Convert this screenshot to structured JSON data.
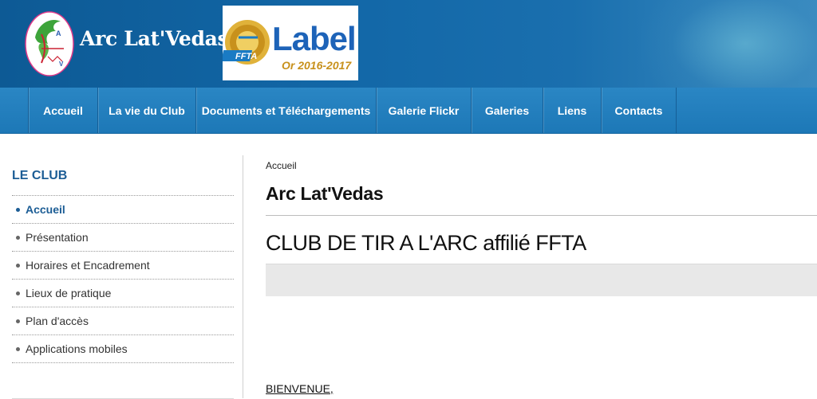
{
  "header": {
    "site_name": "Arc Lat'Vedas",
    "label_logo_text": "Label",
    "label_logo_sub": "Or 2016-2017",
    "label_logo_badge": "FFTA"
  },
  "nav": {
    "items": [
      {
        "label": "Accueil"
      },
      {
        "label": "La vie du Club"
      },
      {
        "label": "Documents et Téléchargements"
      },
      {
        "label": "Galerie Flickr"
      },
      {
        "label": "Galeries"
      },
      {
        "label": "Liens"
      },
      {
        "label": "Contacts"
      }
    ]
  },
  "sidebar": {
    "title": "LE CLUB",
    "items": [
      {
        "label": "Accueil",
        "active": true
      },
      {
        "label": "Présentation"
      },
      {
        "label": "Horaires et Encadrement"
      },
      {
        "label": "Lieux de pratique"
      },
      {
        "label": "Plan d'accès"
      },
      {
        "label": "Applications mobiles"
      }
    ]
  },
  "main": {
    "breadcrumb": "Accueil",
    "title": "Arc Lat'Vedas",
    "subtitle": "CLUB DE TIR A L'ARC affilié FFTA",
    "welcome": "BIENVENUE,"
  },
  "colors": {
    "header_blue": "#1368a8",
    "nav_blue": "#2a86c4",
    "sidebar_title": "#1c5d95"
  }
}
